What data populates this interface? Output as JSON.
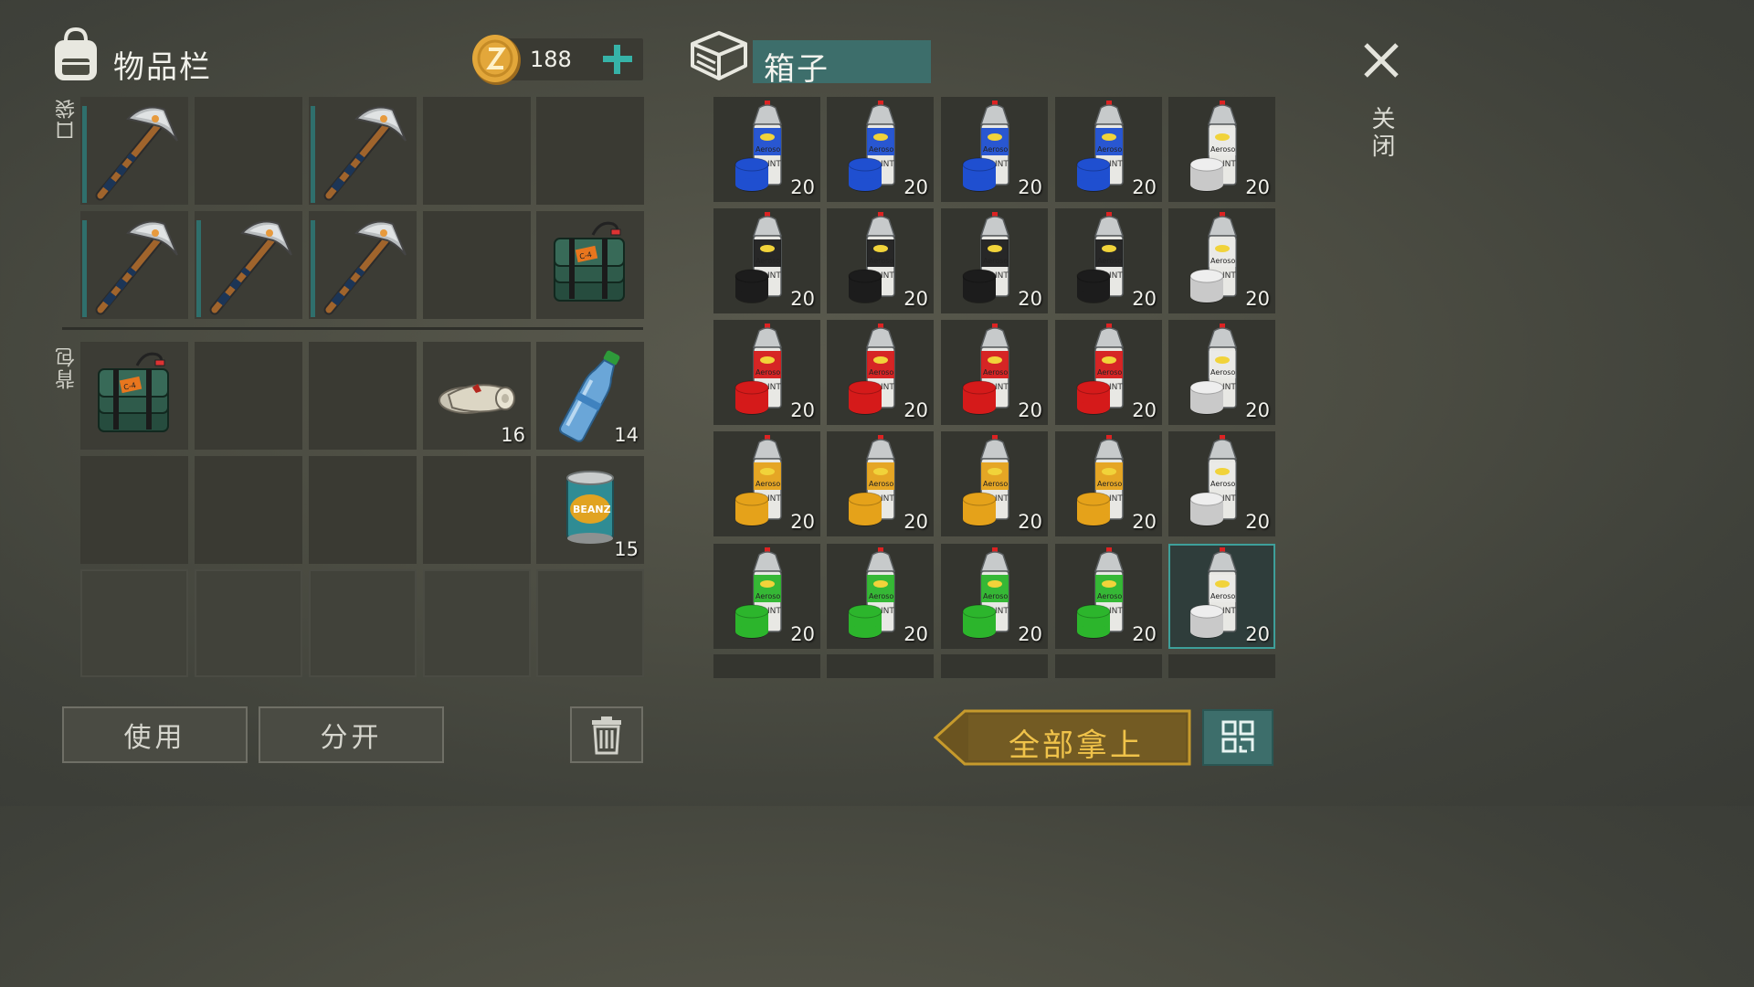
{
  "inventory": {
    "title": "物品栏",
    "coins": "188",
    "pocket_label": "口袋",
    "backpack_label": "背包",
    "pocket_slots": [
      {
        "item": "pickaxe",
        "qty": ""
      },
      {
        "item": "",
        "qty": ""
      },
      {
        "item": "pickaxe",
        "qty": ""
      },
      {
        "item": "",
        "qty": ""
      },
      {
        "item": "",
        "qty": ""
      },
      {
        "item": "pickaxe",
        "qty": ""
      },
      {
        "item": "pickaxe",
        "qty": ""
      },
      {
        "item": "pickaxe",
        "qty": ""
      },
      {
        "item": "",
        "qty": ""
      },
      {
        "item": "c4-explosive",
        "qty": ""
      }
    ],
    "backpack_slots": [
      {
        "item": "c4-explosive",
        "qty": ""
      },
      {
        "item": "",
        "qty": ""
      },
      {
        "item": "",
        "qty": ""
      },
      {
        "item": "bandage",
        "qty": "16"
      },
      {
        "item": "water-bottle",
        "qty": "14"
      },
      {
        "item": "",
        "qty": ""
      },
      {
        "item": "",
        "qty": ""
      },
      {
        "item": "",
        "qty": ""
      },
      {
        "item": "",
        "qty": ""
      },
      {
        "item": "beans-can",
        "qty": "15"
      }
    ],
    "can_label": "BEANZ",
    "c4_label": "C-4"
  },
  "crate": {
    "title": "箱子",
    "spray_label_1": "Aeroso",
    "spray_label_2": "PAINT",
    "colors": {
      "blue": "#1f4fd0",
      "black": "#1c1c1c",
      "red": "#d51a1a",
      "yellow": "#e5a21a",
      "green": "#2cb52c",
      "white": "#eeeeee"
    },
    "rows": [
      [
        "blue",
        "blue",
        "blue",
        "blue",
        "white"
      ],
      [
        "black",
        "black",
        "black",
        "black",
        "white"
      ],
      [
        "red",
        "red",
        "red",
        "red",
        "white"
      ],
      [
        "yellow",
        "yellow",
        "yellow",
        "yellow",
        "white"
      ],
      [
        "green",
        "green",
        "green",
        "green",
        "white"
      ]
    ],
    "qty": "20",
    "selected_slot": "row-5-col-5"
  },
  "buttons": {
    "use": "使用",
    "split": "分开",
    "take_all": "全部拿上",
    "close": "关闭"
  },
  "theme": {
    "accent": "#3d6e6b",
    "take_all_color": "#f0c34a"
  }
}
